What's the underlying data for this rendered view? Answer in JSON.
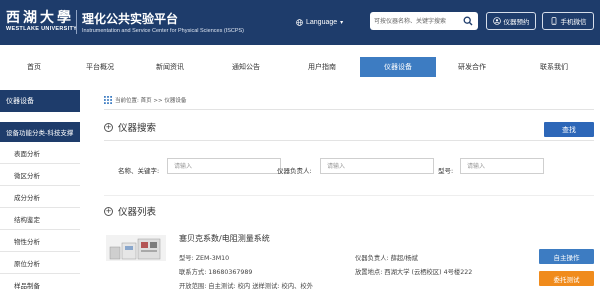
{
  "header": {
    "logo_cn": "西湖大學",
    "logo_en": "WESTLAKE UNIVERSITY",
    "platform_cn": "理化公共实验平台",
    "platform_en": "Instrumentation and Service Center for Physical Sciences (ISCPS)",
    "language_label": "Language",
    "search_placeholder": "可按仪器名称、关键字搜索",
    "booking_label": "仪器预约",
    "wechat_label": "手机微信"
  },
  "nav": {
    "active_index": 6,
    "items": [
      "首页",
      "平台概况",
      "新闻资讯",
      "通知公告",
      "用户指南",
      "仪器设备",
      "研发合作",
      "联系我们"
    ]
  },
  "sidebar": {
    "title": "仪器设备",
    "subtitle": "设备功能分类-科技支撑",
    "items": [
      "表面分析",
      "微区分析",
      "成分分析",
      "结构鉴定",
      "物性分析",
      "原位分析",
      "样品制备"
    ]
  },
  "breadcrumb": "当前位置: 首页 >> 仪器设备",
  "search_section": {
    "title": "仪器搜索",
    "query_button": "查找",
    "fields": [
      {
        "label": "名称、关键字:",
        "placeholder": "请输入"
      },
      {
        "label": "仪器负责人:",
        "placeholder": "请输入"
      },
      {
        "label": "型号:",
        "placeholder": "请输入"
      }
    ]
  },
  "list_section": {
    "title": "仪器列表",
    "item": {
      "title": "塞贝克系数/电阻测量系统",
      "model": "型号: ZEM-3M10",
      "contact": "联系方式: 18680367989",
      "open_scope": "开放范围: 自主测试: 校内 送样测试: 校内、校外",
      "owner": "仪器负责人: 薛超/杨斌",
      "location": "放置地点: 西湖大学 (云栖校区) 4号楼222",
      "self_op_button": "自主操作",
      "test_button": "委托测试"
    }
  },
  "colors": {
    "brand_navy": "#1e3c6b",
    "nav_active": "#3d7cc2",
    "query_blue": "#2d67b8",
    "orange": "#f08b1c"
  },
  "icons": {
    "language": "globe-icon",
    "search": "search-icon",
    "booking": "user-icon",
    "wechat": "phone-icon",
    "breadcrumb": "grid-icon",
    "section": "plus-circle-icon"
  }
}
